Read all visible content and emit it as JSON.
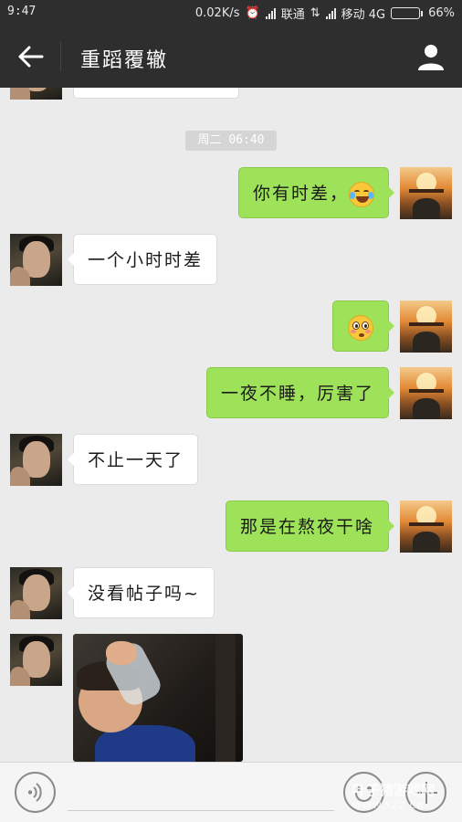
{
  "status_bar": {
    "time": "9:47",
    "speed": "0.02K/s",
    "carrier1": "联通",
    "carrier2": "移动 4G",
    "battery": "66%",
    "battery_level": 0.66
  },
  "header": {
    "title": "重蹈覆辙",
    "icons": [
      "back-arrow-icon",
      "person-icon"
    ]
  },
  "chat": {
    "timestamp": "周二 06:40",
    "messages": [
      {
        "from": "me",
        "text": "你有时差，",
        "emoji": "tears-of-joy-emoji"
      },
      {
        "from": "friend",
        "text": "一个小时时差"
      },
      {
        "from": "me",
        "text": "",
        "emoji": "flushed-face-emoji"
      },
      {
        "from": "me",
        "text": "一夜不睡，厉害了"
      },
      {
        "from": "friend",
        "text": "不止一天了"
      },
      {
        "from": "me",
        "text": "那是在熬夜干啥"
      },
      {
        "from": "friend",
        "text": "没看帖子吗~"
      },
      {
        "from": "friend",
        "type": "image",
        "text": ""
      }
    ]
  },
  "input_bar": {
    "icons": [
      "voice-icon",
      "emoji-icon",
      "plus-icon"
    ]
  },
  "watermark": {
    "line1": "叶子猪游戏网",
    "line2": "WWW.YZZ.CN"
  },
  "colors": {
    "bar": "#2e2e2e",
    "background": "#ebebeb",
    "outgoing_bubble": "#9ee25a",
    "incoming_bubble": "#ffffff",
    "battery": "#f5a012"
  }
}
